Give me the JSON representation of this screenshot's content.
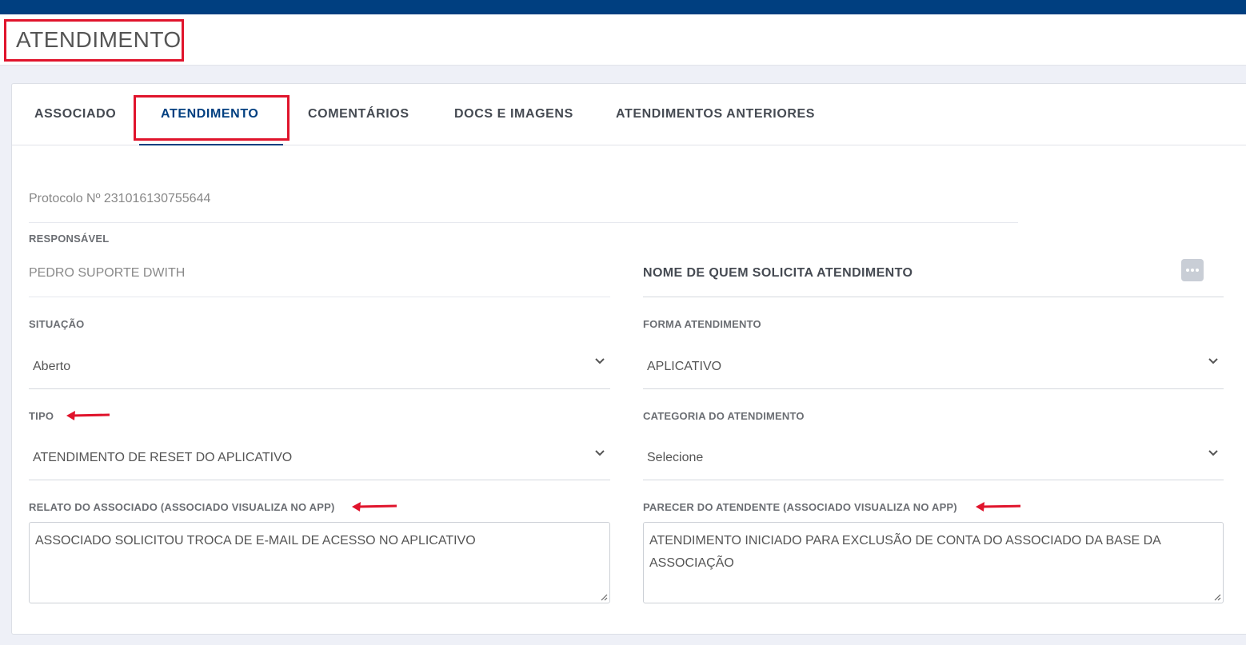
{
  "header": {
    "title": "ATENDIMENTO"
  },
  "tabs": [
    {
      "label": "ASSOCIADO"
    },
    {
      "label": "ATENDIMENTO",
      "active": true
    },
    {
      "label": "COMENTÁRIOS"
    },
    {
      "label": "DOCS E IMAGENS"
    },
    {
      "label": "ATENDIMENTOS ANTERIORES"
    }
  ],
  "protocol": "Protocolo Nº 231016130755644",
  "form": {
    "responsavel": {
      "label": "RESPONSÁVEL",
      "value": "PEDRO SUPORTE DWITH"
    },
    "solicitante": {
      "value": "NOME DE QUEM SOLICITA ATENDIMENTO"
    },
    "situacao": {
      "label": "SITUAÇÃO",
      "value": "Aberto"
    },
    "forma": {
      "label": "FORMA ATENDIMENTO",
      "value": "APLICATIVO"
    },
    "tipo": {
      "label": "TIPO",
      "value": "ATENDIMENTO DE RESET DO APLICATIVO"
    },
    "categoria": {
      "label": "CATEGORIA DO ATENDIMENTO",
      "value": "Selecione"
    },
    "relato": {
      "label": "RELATO DO ASSOCIADO (ASSOCIADO VISUALIZA NO APP)",
      "value": "ASSOCIADO SOLICITOU TROCA DE E-MAIL DE ACESSO NO APLICATIVO"
    },
    "parecer": {
      "label": "PARECER DO ATENDENTE (ASSOCIADO VISUALIZA NO APP)",
      "line1": "ATENDIMENTO INICIADO PARA EXCLUSÃO DE CONTA DO ASSOCIADO DA BASE DA",
      "line2": "ASSOCIAÇÃO"
    }
  },
  "colors": {
    "topbar": "#003f80",
    "highlight": "#e0142c",
    "accent": "#003f80"
  },
  "icons": {
    "more": "more-dots-icon",
    "select": "chevron-down-icon",
    "annotation": "red-arrow-icon"
  }
}
